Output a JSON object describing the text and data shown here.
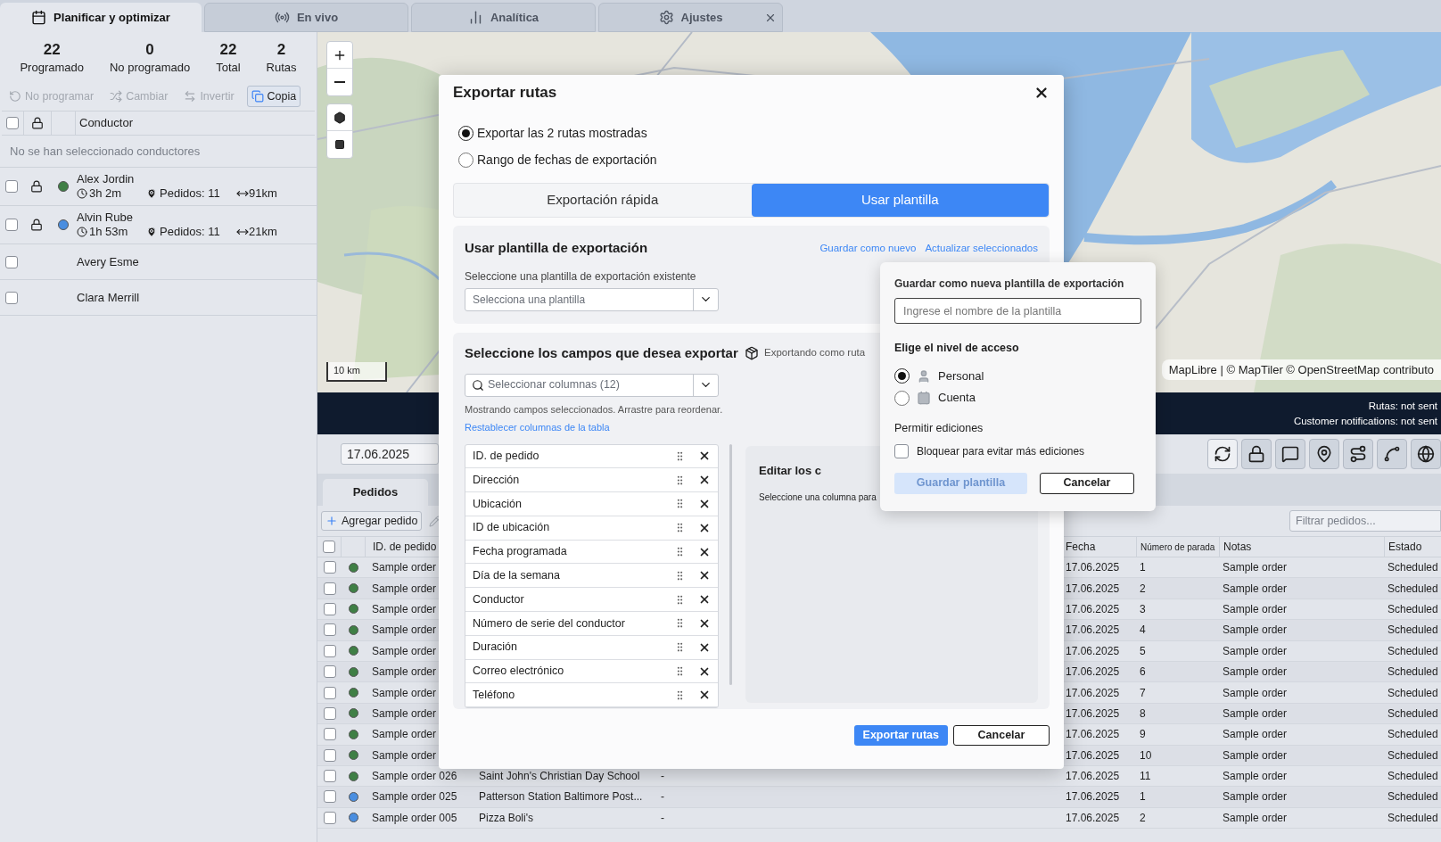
{
  "tabs": [
    {
      "label": "Planificar y optimizar",
      "selected": true
    },
    {
      "label": "En vivo",
      "selected": false
    },
    {
      "label": "Analítica",
      "selected": false
    },
    {
      "label": "Ajustes",
      "selected": false
    }
  ],
  "summary": [
    {
      "value": "22",
      "label": "Programado"
    },
    {
      "value": "0",
      "label": "No programado"
    },
    {
      "value": "22",
      "label": "Total"
    },
    {
      "value": "2",
      "label": "Rutas"
    }
  ],
  "driver_actions": [
    {
      "label": "No programar",
      "disabled": true
    },
    {
      "label": "Cambiar",
      "disabled": true
    },
    {
      "label": "Invertir",
      "disabled": true
    },
    {
      "label": "Copia",
      "disabled": false
    }
  ],
  "drivers": {
    "column": "Conductor",
    "header_checked": false,
    "empty_message": "No se han seleccionado conductores",
    "rows": [
      {
        "kind": "route",
        "name": "Alex Jordin",
        "checked": false,
        "color": "#3f7f45",
        "duration": "3h 2m",
        "orders": "Pedidos: 11",
        "distance": "91km"
      },
      {
        "kind": "route",
        "name": "Alvin Rube",
        "checked": false,
        "color": "#4a8ee0",
        "duration": "1h 53m",
        "orders": "Pedidos: 11",
        "distance": "21km"
      },
      {
        "kind": "plain",
        "name": "Avery Esme",
        "checked": false
      },
      {
        "kind": "plain",
        "name": "Clara Merrill",
        "checked": false
      }
    ]
  },
  "map": {
    "scale": "10 km",
    "attribution": "MapLibre | © MapTiler © OpenStreetMap contributo"
  },
  "status_bar": {
    "routes": "Rutas: not sent",
    "notifications": "Customer notifications: not sent"
  },
  "date": "17.06.2025",
  "orders_tab": {
    "label": "Pedidos",
    "selected": true
  },
  "add_order": "Agregar pedido",
  "filter": {
    "placeholder": "Filtrar pedidos..."
  },
  "orders_table": {
    "header_checked": false,
    "columns": {
      "id": "ID. de pedido",
      "date": "Fecha",
      "stop": "Número de parada",
      "notes": "Notas",
      "status": "Estado"
    },
    "rows": [
      {
        "checked": false,
        "color": "#3f7f45",
        "id": "Sample order",
        "date": "17.06.2025",
        "stop": "1",
        "notes": "Sample order",
        "status": "Scheduled"
      },
      {
        "checked": false,
        "color": "#3f7f45",
        "id": "Sample order",
        "date": "17.06.2025",
        "stop": "2",
        "notes": "Sample order",
        "status": "Scheduled"
      },
      {
        "checked": false,
        "color": "#3f7f45",
        "id": "Sample order",
        "date": "17.06.2025",
        "stop": "3",
        "notes": "Sample order",
        "status": "Scheduled"
      },
      {
        "checked": false,
        "color": "#3f7f45",
        "id": "Sample order",
        "date": "17.06.2025",
        "stop": "4",
        "notes": "Sample order",
        "status": "Scheduled"
      },
      {
        "checked": false,
        "color": "#3f7f45",
        "id": "Sample order",
        "date": "17.06.2025",
        "stop": "5",
        "notes": "Sample order",
        "status": "Scheduled"
      },
      {
        "checked": false,
        "color": "#3f7f45",
        "id": "Sample order",
        "date": "17.06.2025",
        "stop": "6",
        "notes": "Sample order",
        "status": "Scheduled"
      },
      {
        "checked": false,
        "color": "#3f7f45",
        "id": "Sample order",
        "date": "17.06.2025",
        "stop": "7",
        "notes": "Sample order",
        "status": "Scheduled"
      },
      {
        "checked": false,
        "color": "#3f7f45",
        "id": "Sample order",
        "date": "17.06.2025",
        "stop": "8",
        "notes": "Sample order",
        "status": "Scheduled"
      },
      {
        "checked": false,
        "color": "#3f7f45",
        "id": "Sample order",
        "date": "17.06.2025",
        "stop": "9",
        "notes": "Sample order",
        "status": "Scheduled"
      },
      {
        "checked": false,
        "color": "#3f7f45",
        "id": "Sample order",
        "date": "17.06.2025",
        "stop": "10",
        "notes": "Sample order",
        "status": "Scheduled"
      },
      {
        "checked": false,
        "color": "#3f7f45",
        "id": "Sample order 026",
        "address": "Saint John's Christian Day School",
        "extra": "-",
        "date": "17.06.2025",
        "stop": "11",
        "notes": "Sample order",
        "status": "Scheduled"
      },
      {
        "checked": false,
        "color": "#4a8ee0",
        "id": "Sample order 025",
        "address": "Patterson Station Baltimore Post...",
        "extra": "-",
        "date": "17.06.2025",
        "stop": "1",
        "notes": "Sample order",
        "status": "Scheduled"
      },
      {
        "checked": false,
        "color": "#4a8ee0",
        "id": "Sample order 005",
        "address": "Pizza Boli's",
        "extra": "-",
        "date": "17.06.2025",
        "stop": "2",
        "notes": "Sample order",
        "status": "Scheduled"
      }
    ]
  },
  "dialog": {
    "title": "Exportar rutas",
    "scope": [
      {
        "label": "Exportar las 2 rutas mostradas",
        "selected": true
      },
      {
        "label": "Rango de fechas de exportación",
        "selected": false
      }
    ],
    "modes": [
      {
        "label": "Exportación rápida",
        "selected": false
      },
      {
        "label": "Usar plantilla",
        "selected": true
      }
    ],
    "template": {
      "title": "Usar plantilla de exportación",
      "links": [
        "Guardar como nuevo",
        "Actualizar seleccionados"
      ],
      "select_label": "Seleccione una plantilla de exportación existente",
      "select_placeholder": "Selecciona una plantilla"
    },
    "fields": {
      "title": "Seleccione los campos que desea exportar",
      "export_as": "Exportando como ruta",
      "search_placeholder": "Seleccionar columnas (12)",
      "hint": "Mostrando campos seleccionados. Arrastre para reordenar.",
      "reset_link": "Restablecer columnas de la tabla",
      "items": [
        "ID. de pedido",
        "Dirección",
        "Ubicación",
        "ID de ubicación",
        "Fecha programada",
        "Día de la semana",
        "Conductor",
        "Número de serie del conductor",
        "Duración",
        "Correo electrónico",
        "Teléfono"
      ]
    },
    "editor": {
      "title": "Editar los c",
      "hint": "Seleccione una columna para"
    },
    "buttons": {
      "primary": "Exportar rutas",
      "secondary": "Cancelar"
    }
  },
  "save_popover": {
    "title": "Guardar como nueva plantilla de exportación",
    "name_placeholder": "Ingrese el nombre de la plantilla",
    "access_label": "Elige el nivel de acceso",
    "access": [
      {
        "label": "Personal",
        "selected": true
      },
      {
        "label": "Cuenta",
        "selected": false
      }
    ],
    "edits_label": "Permitir ediciones",
    "lock": {
      "label": "Bloquear para evitar más ediciones",
      "checked": false
    },
    "save": {
      "label": "Guardar plantilla",
      "disabled": true
    },
    "cancel": "Cancelar"
  }
}
